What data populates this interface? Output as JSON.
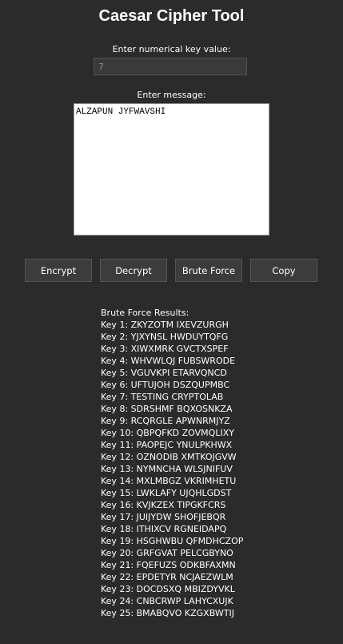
{
  "app": {
    "title": "Caesar Cipher Tool"
  },
  "key": {
    "label": "Enter numerical key value:",
    "value": "7"
  },
  "message": {
    "label": "Enter message:",
    "value": "ALZAPUN JYFWAVSHI"
  },
  "buttons": {
    "encrypt": "Encrypt",
    "decrypt": "Decrypt",
    "brute": "Brute Force",
    "copy": "Copy"
  },
  "results": {
    "heading": "Brute Force Results:",
    "lines": [
      "Key 1: ZKYZOTM IXEVZURGH",
      "Key 2: YJXYNSL HWDUYTQFG",
      "Key 3: XIWXMRK GVCTXSPEF",
      "Key 4: WHVWLQJ FUBSWRODE",
      "Key 5: VGUVKPI ETARVQNCD",
      "Key 6: UFTUJOH DSZQUPMBC",
      "Key 7: TESTING CRYPTOLAB",
      "Key 8: SDRSHMF BQXOSNKZA",
      "Key 9: RCQRGLE APWNRMJYZ",
      "Key 10: QBPQFKD ZOVMQLIXY",
      "Key 11: PAOPEJC YNULPKHWX",
      "Key 12: OZNODIB XMTKOJGVW",
      "Key 13: NYMNCHA WLSJNIFUV",
      "Key 14: MXLMBGZ VKRIMHETU",
      "Key 15: LWKLAFY UJQHLGDST",
      "Key 16: KVJKZEX TIPGKFCRS",
      "Key 17: JUIJYDW SHOFJEBQR",
      "Key 18: ITHIXCV RGNEIDAPQ",
      "Key 19: HSGHWBU QFMDHCZOP",
      "Key 20: GRFGVAT PELCGBYNO",
      "Key 21: FQEFUZS ODKBFAXMN",
      "Key 22: EPDETYR NCJAEZWLM",
      "Key 23: DOCDSXQ MBIZDYVKL",
      "Key 24: CNBCRWP LAHYCXUJK",
      "Key 25: BMABQVO KZGXBWTIJ"
    ]
  }
}
